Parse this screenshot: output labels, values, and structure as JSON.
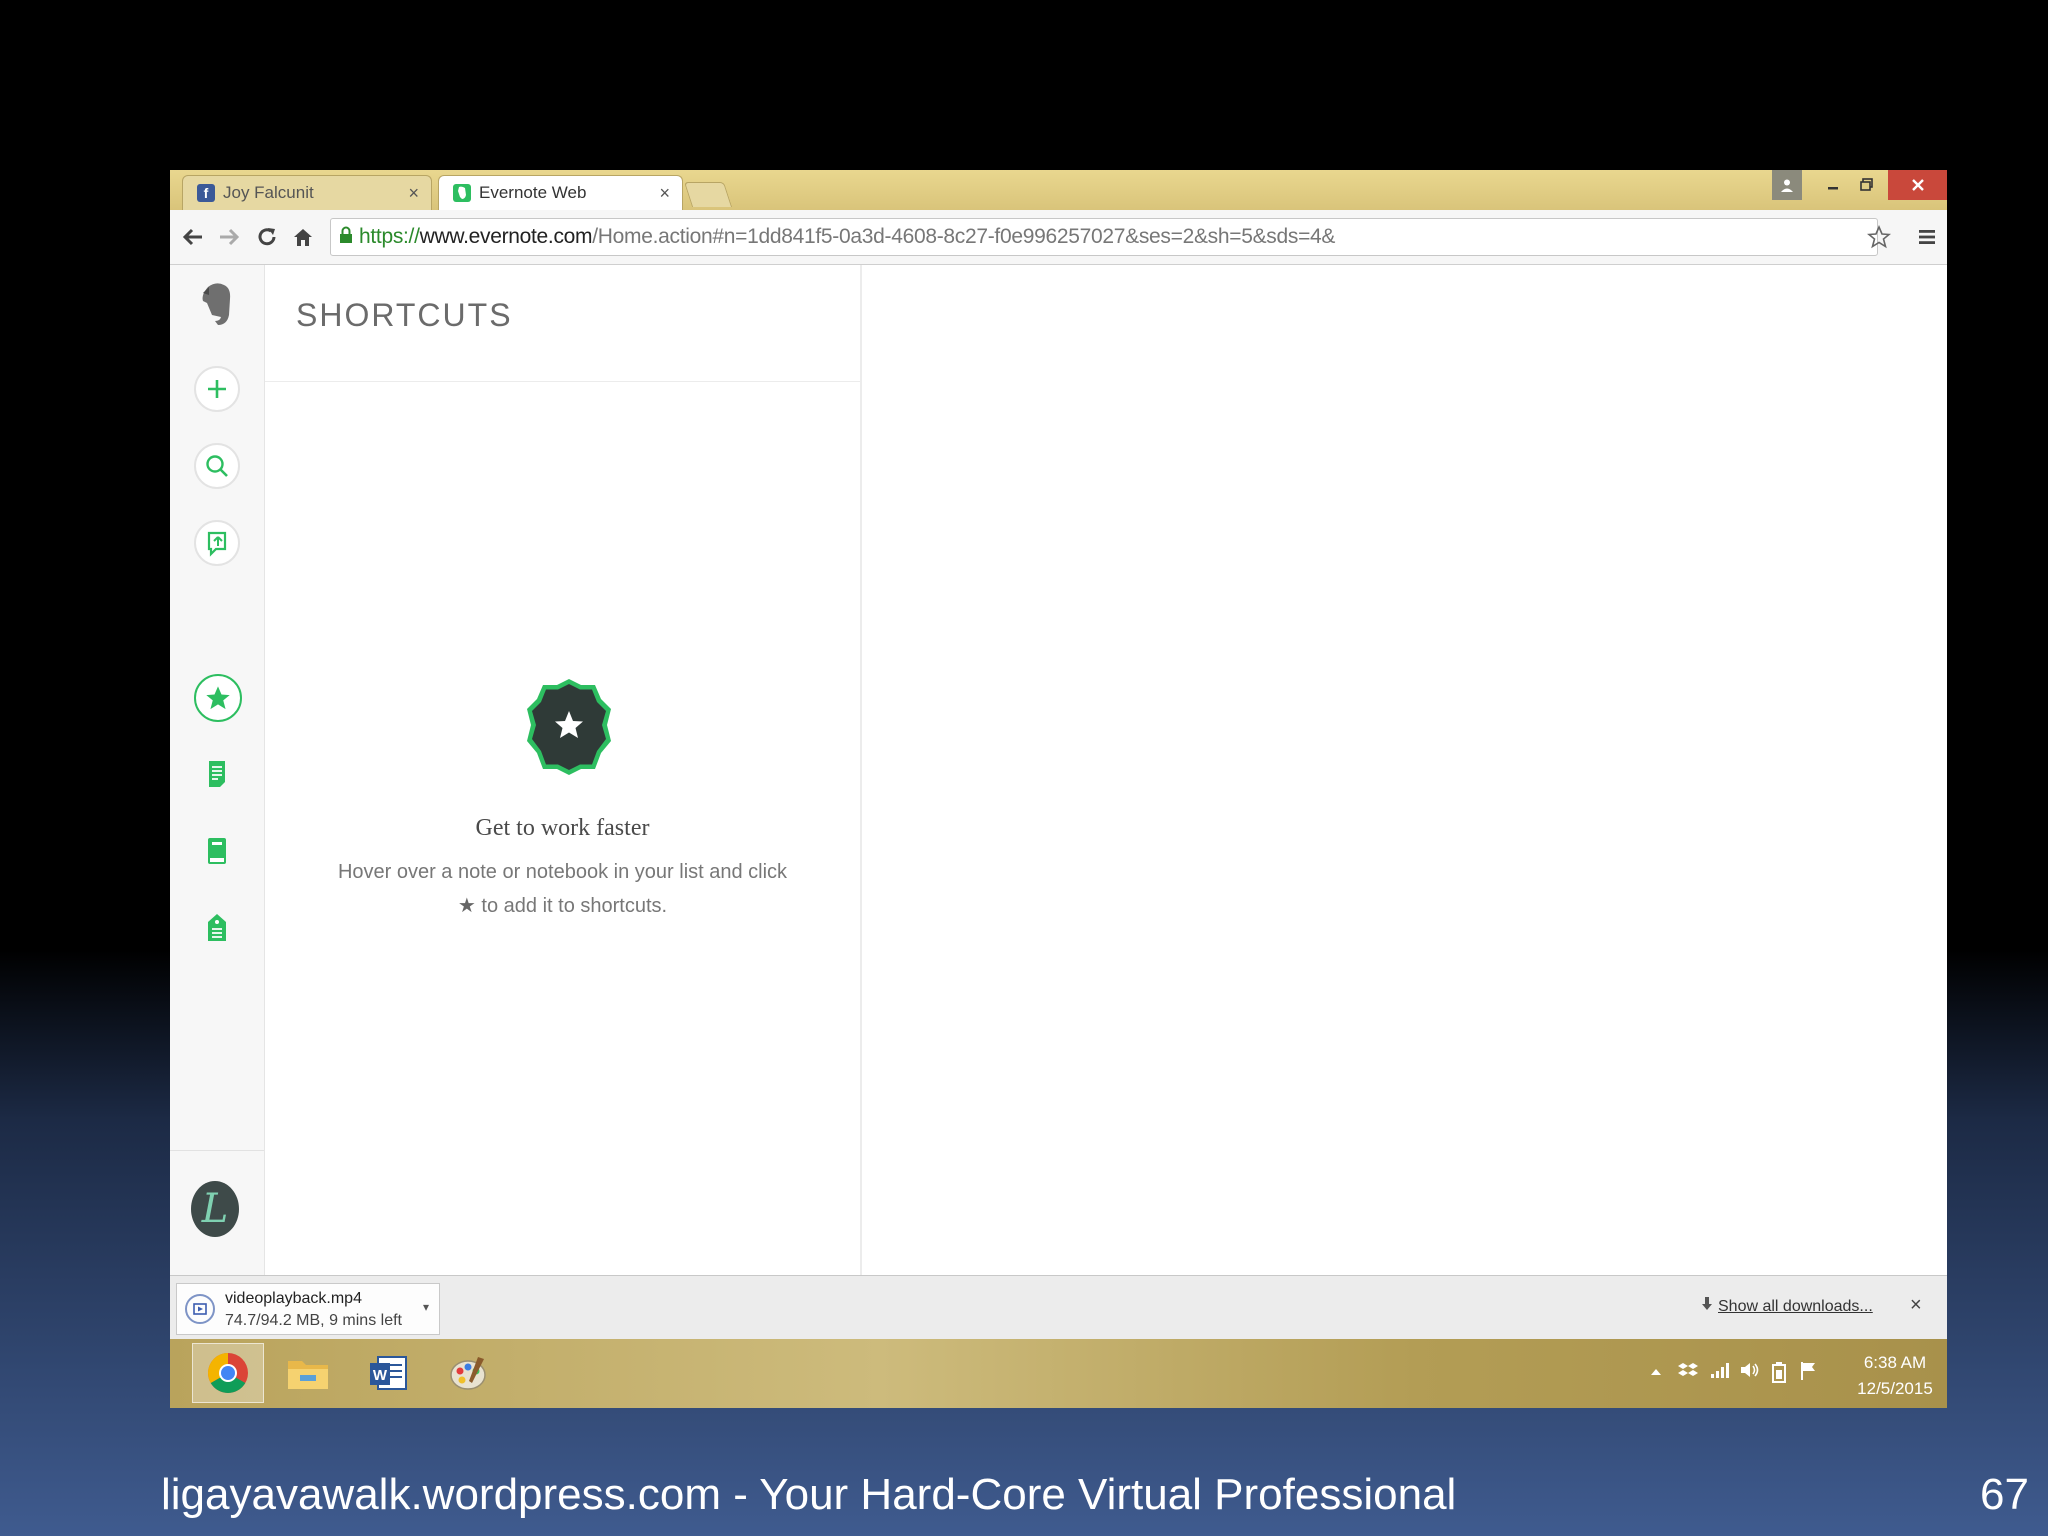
{
  "browser": {
    "tabs": [
      {
        "label": "Joy Falcunit",
        "favicon": "facebook-icon",
        "active": false
      },
      {
        "label": "Evernote Web",
        "favicon": "evernote-icon",
        "active": true
      }
    ],
    "tab_close": "×",
    "url": {
      "scheme": "https://",
      "host": "www.evernote.com",
      "path": "/Home.action#n=1dd841f5-0a3d-4608-8c27-f0e996257027&ses=2&sh=5&sds=4&"
    }
  },
  "evernote": {
    "panel_title": "SHORTCUTS",
    "empty_title": "Get to work faster",
    "empty_line1": "Hover over a note or notebook in your list and click",
    "empty_star": "★",
    "empty_line2": " to add it to shortcuts.",
    "avatar_letter": "L",
    "accent_color": "#2dbe60"
  },
  "downloads": {
    "file_name": "videoplayback.mp4",
    "status": "74.7/94.2 MB, 9 mins left",
    "show_all": "Show all downloads...",
    "close": "×"
  },
  "taskbar": {
    "apps": [
      "chrome-icon",
      "file-explorer-icon",
      "word-icon",
      "paint-icon"
    ],
    "time": "6:38 AM",
    "date": "12/5/2015"
  },
  "slide": {
    "footer": "ligayavawalk.wordpress.com - Your Hard-Core Virtual Professional",
    "number": "67"
  }
}
